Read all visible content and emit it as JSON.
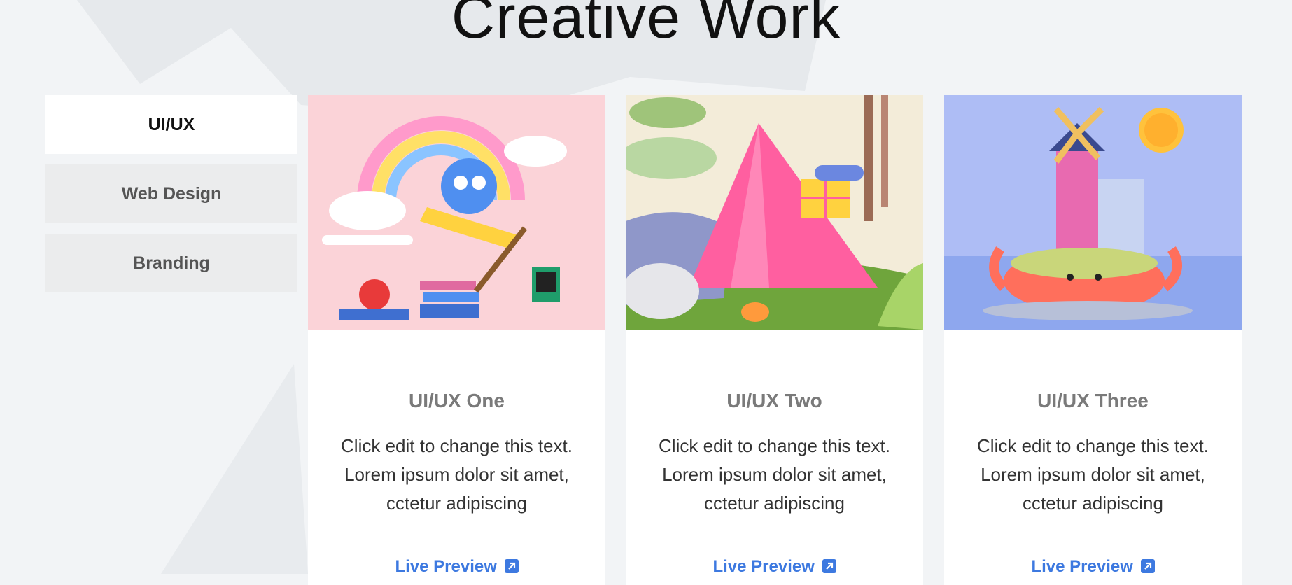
{
  "section": {
    "title": "Creative Work"
  },
  "tabs": [
    {
      "label": "UI/UX",
      "active": true
    },
    {
      "label": "Web Design",
      "active": false
    },
    {
      "label": "Branding",
      "active": false
    }
  ],
  "cards": [
    {
      "title": "UI/UX One",
      "text": "Click edit to change this text. Lorem ipsum dolor sit amet, cctetur adipiscing",
      "link": "Live Preview",
      "image": "rainbow-pencil-illustration"
    },
    {
      "title": "UI/UX Two",
      "text": "Click edit to change this text. Lorem ipsum dolor sit amet, cctetur adipiscing",
      "link": "Live Preview",
      "image": "pink-tent-illustration"
    },
    {
      "title": "UI/UX Three",
      "text": "Click edit to change this text. Lorem ipsum dolor sit amet, cctetur adipiscing",
      "link": "Live Preview",
      "image": "crab-castle-illustration"
    }
  ],
  "colors": {
    "accent": "#3d79e0",
    "background": "#f2f4f6",
    "card": "#ffffff"
  }
}
